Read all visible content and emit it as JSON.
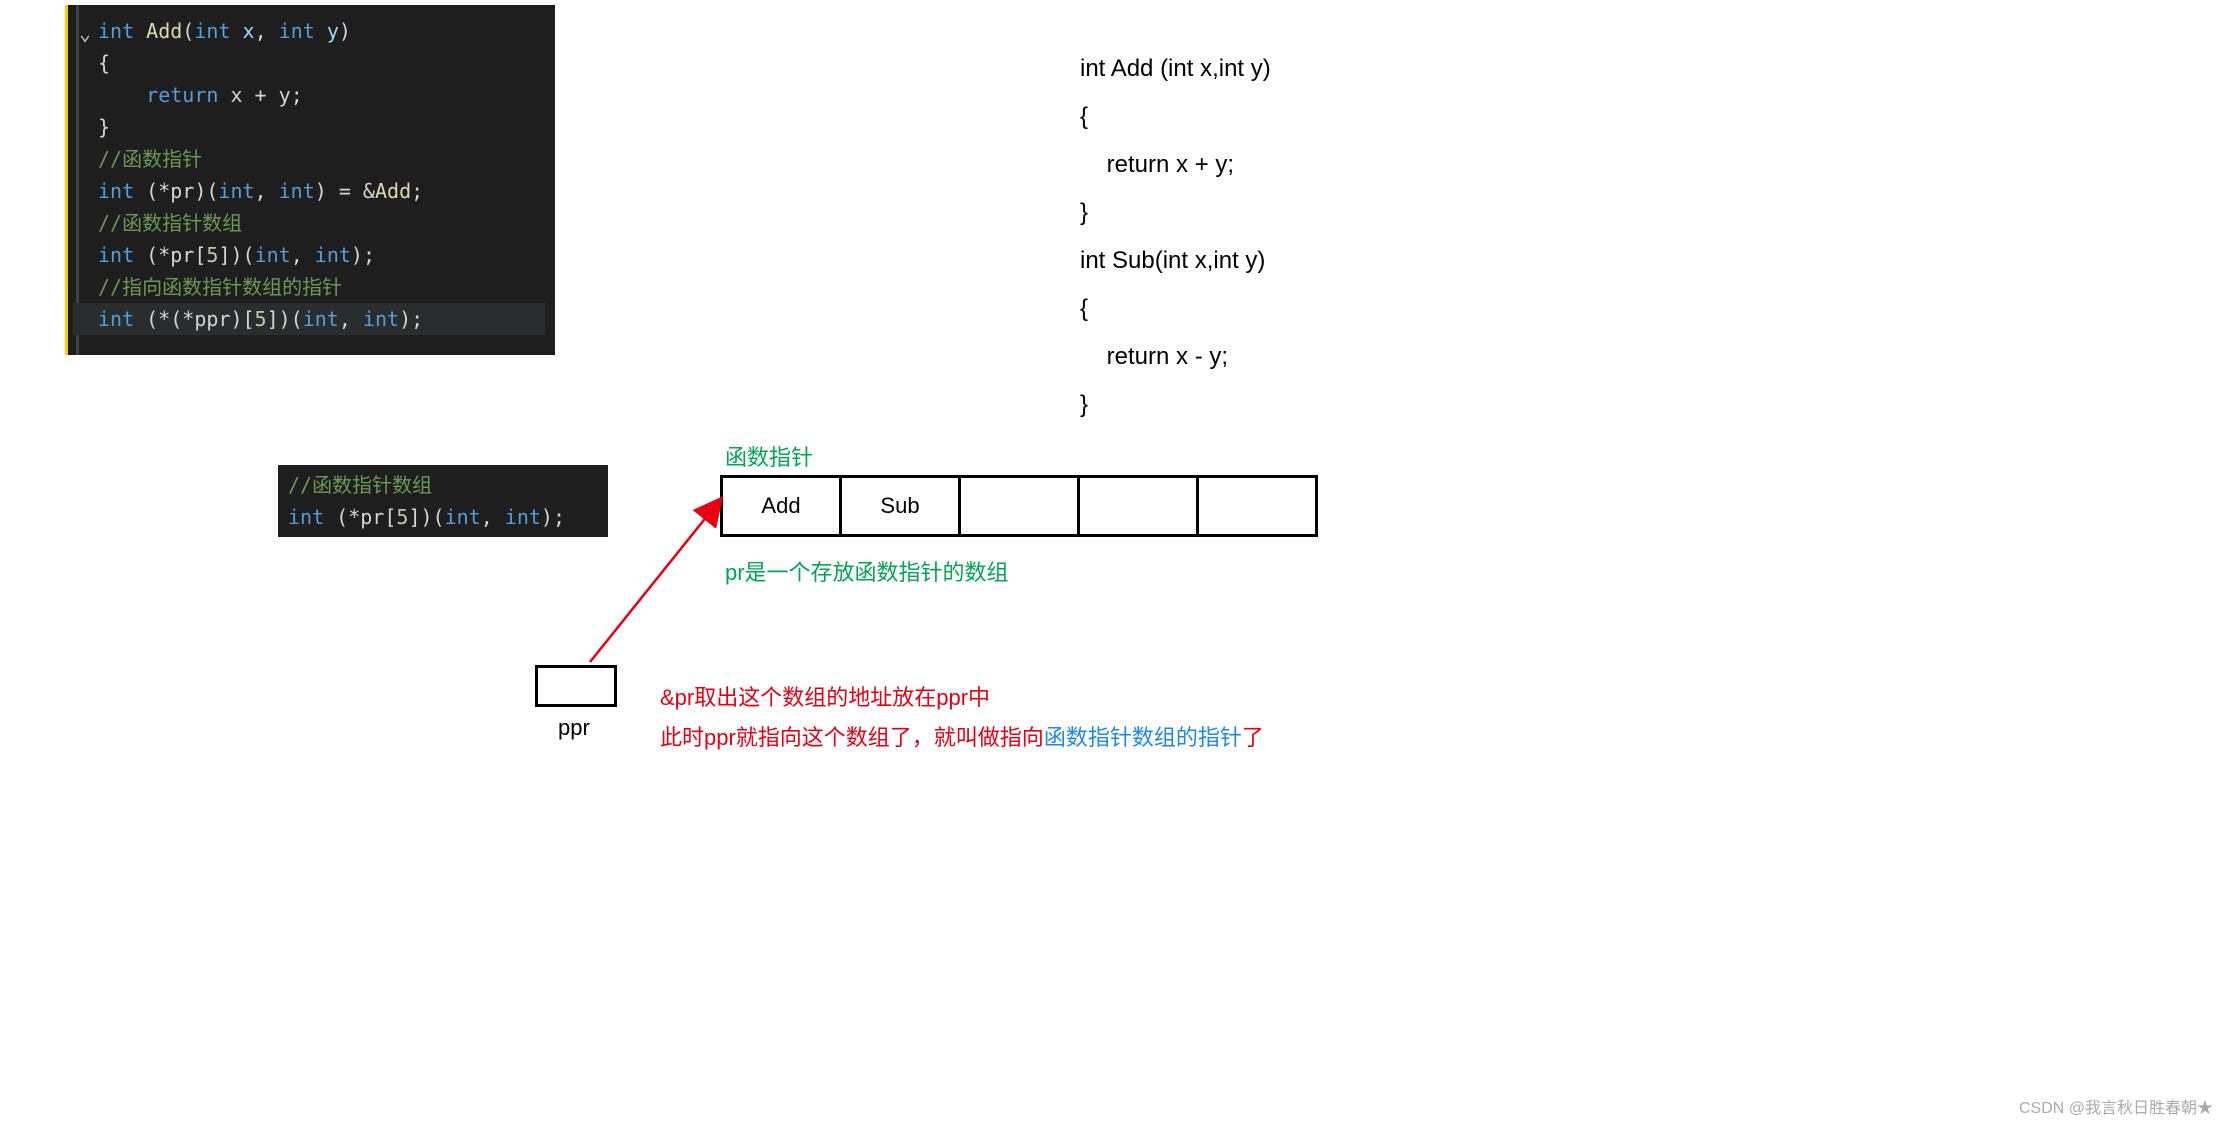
{
  "code1": {
    "l1_kw": "int",
    "l1_fn": "Add",
    "l1_p1": "int",
    "l1_p1n": "x",
    "l1_p2": "int",
    "l1_p2n": "y",
    "l2": "{",
    "l3_kw": "return",
    "l3_expr": "x + y",
    "l4": "}",
    "l5_comment": "//函数指针",
    "l6_kw": "int",
    "l6_body": "(*pr)(",
    "l6_i1": "int",
    "l6_c1": ", ",
    "l6_i2": "int",
    "l6_end": ") = &",
    "l6_fn": "Add",
    "l7_comment": "//函数指针数组",
    "l8_kw": "int",
    "l8_body": "(*pr[",
    "l8_num": "5",
    "l8_mid": "])(",
    "l8_i1": "int",
    "l8_c": ", ",
    "l8_i2": "int",
    "l8_end": ");",
    "l9_comment": "//指向函数指针数组的指针",
    "l10_kw": "int",
    "l10_body": "(*(*ppr)[",
    "l10_num": "5",
    "l10_mid": "])(",
    "l10_i1": "int",
    "l10_c": ", ",
    "l10_i2": "int",
    "l10_end": ");"
  },
  "code_right": {
    "l1": "int Add (int x,int y)",
    "l2": "{",
    "l3": "    return x + y;",
    "l4": "}",
    "l5": "int Sub(int x,int y)",
    "l6": "{",
    "l7": "    return x - y;",
    "l8": "}"
  },
  "code2": {
    "l1_comment": "//函数指针数组",
    "l2_kw": "int",
    "l2_body": "(*pr[",
    "l2_num": "5",
    "l2_mid": "])(",
    "l2_i1": "int",
    "l2_c": ", ",
    "l2_i2": "int",
    "l2_end": ");"
  },
  "labels": {
    "top": "函数指针",
    "bottom": "pr是一个存放函数指针的数组"
  },
  "cells": [
    "Add",
    "Sub",
    "",
    "",
    ""
  ],
  "ppr": "ppr",
  "redtext": {
    "l1": "&pr取出这个数组的地址放在ppr中",
    "l2a": "此时ppr就指向这个数组了，就叫做指向",
    "l2b": "函数指针数组的指针",
    "l2c": "了"
  },
  "watermark": "CSDN @我言秋日胜春朝★"
}
